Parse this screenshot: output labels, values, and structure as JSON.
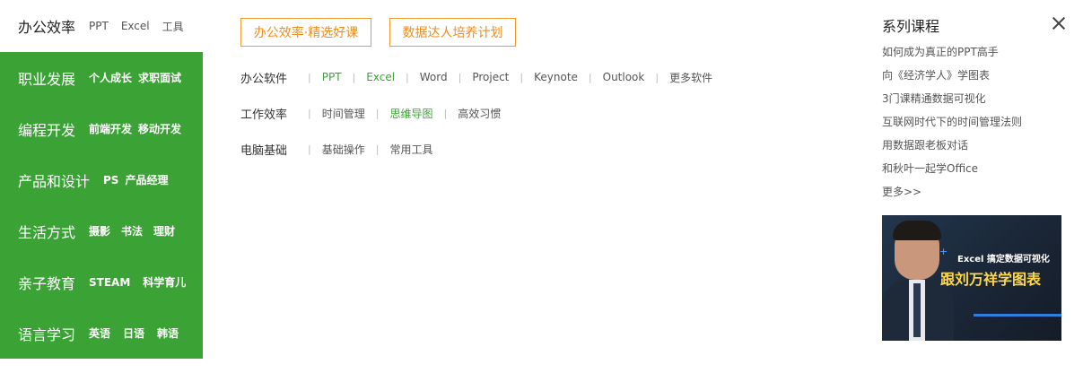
{
  "nav": {
    "active": {
      "label": "办公效率",
      "subs": [
        "PPT",
        "Excel",
        "工具"
      ]
    },
    "categories": [
      {
        "label": "职业发展",
        "subs": [
          "个人成长",
          "求职面试"
        ]
      },
      {
        "label": "编程开发",
        "subs": [
          "前端开发",
          "移动开发"
        ]
      },
      {
        "label": "产品和设计",
        "subs": [
          "PS",
          "产品经理"
        ]
      },
      {
        "label": "生活方式",
        "subs": [
          "摄影",
          "书法",
          "理财"
        ]
      },
      {
        "label": "亲子教育",
        "subs": [
          "STEAM",
          "科学育儿"
        ]
      },
      {
        "label": "语言学习",
        "subs": [
          "英语",
          "日语",
          "韩语"
        ]
      }
    ],
    "colors": {
      "active_bg": "#ffffff",
      "green_bg": "#3ba335"
    }
  },
  "tags": [
    "办公效率·精选好课",
    "数据达人培养计划"
  ],
  "rows": [
    {
      "label": "办公软件",
      "items": [
        {
          "text": "PPT",
          "highlight": true
        },
        {
          "text": "Excel",
          "highlight": true
        },
        {
          "text": "Word",
          "highlight": false
        },
        {
          "text": "Project",
          "highlight": false
        },
        {
          "text": "Keynote",
          "highlight": false
        },
        {
          "text": "Outlook",
          "highlight": false
        },
        {
          "text": "更多软件",
          "highlight": false
        }
      ]
    },
    {
      "label": "工作效率",
      "items": [
        {
          "text": "时间管理",
          "highlight": false
        },
        {
          "text": "思维导图",
          "highlight": true
        },
        {
          "text": "高效习惯",
          "highlight": false
        }
      ]
    },
    {
      "label": "电脑基础",
      "items": [
        {
          "text": "基础操作",
          "highlight": false
        },
        {
          "text": "常用工具",
          "highlight": false
        }
      ]
    }
  ],
  "series": {
    "title": "系列课程",
    "close_icon": "close-icon",
    "courses": [
      "如何成为真正的PPT高手",
      "向《经济学人》学图表",
      "3门课精通数据可视化",
      "互联网时代下的时间管理法则",
      "用数据跟老板对话",
      "和秋叶一起学Office",
      "更多>>"
    ],
    "banner": {
      "line1": "Excel 搞定数据可视化",
      "line2": "跟刘万祥学图表"
    }
  },
  "accent_colors": {
    "green": "#3ba335",
    "orange": "#f08c1c"
  }
}
